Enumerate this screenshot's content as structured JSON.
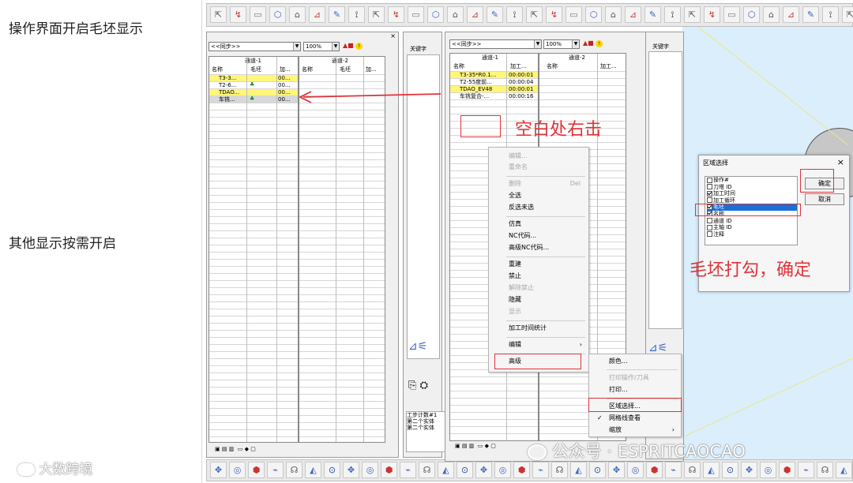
{
  "notes": {
    "left_top": "操作界面开启毛坯显示",
    "left_bottom": "其他显示按需开启",
    "right_click_hint": "空白处右击",
    "check_hint": "毛坯打勾，确定"
  },
  "watermarks": {
    "logo": "大数跨境",
    "wechat": "公众号 · ESPRITCAOCAO"
  },
  "panel_left": {
    "sync_combo": "<<同步>>",
    "zoom_combo": "100%",
    "channel1": "通道-1",
    "channel2": "通道-2",
    "cols1": [
      "名称",
      "毛坯",
      "加..."
    ],
    "cols2": [
      "名称",
      "毛坯",
      "加..."
    ],
    "rows": [
      {
        "name": "T3-3...",
        "stock": "",
        "time": "00...",
        "highlight": true
      },
      {
        "name": "T2-6...",
        "stock": "stock-icon",
        "time": "00...",
        "highlight": false
      },
      {
        "name": "TDAO...",
        "stock": "",
        "time": "00...",
        "highlight": true
      },
      {
        "name": "车铣...",
        "stock": "stock-icon",
        "time": "00...",
        "highlight": false,
        "gray": true
      }
    ],
    "keyword": "关键字"
  },
  "panel_right": {
    "sync_combo": "<<同步>>",
    "zoom_combo": "100%",
    "channel1": "通道-1",
    "channel2": "通道-2",
    "cols1": [
      "名称",
      "加工..."
    ],
    "cols2": [
      "名称",
      "加工..."
    ],
    "rows": [
      {
        "name": "T3-35*R0.1...",
        "time": "00:00:01",
        "highlight": true
      },
      {
        "name": "T2-55度前...",
        "time": "00:00:04",
        "highlight": false
      },
      {
        "name": "TDAO_EV48",
        "time": "00:00:01",
        "highlight": true
      },
      {
        "name": "车铣复合-...",
        "time": "00:00:16",
        "highlight": false
      }
    ],
    "keyword": "关键字"
  },
  "context_menu": {
    "items": [
      {
        "label": "编辑...",
        "disabled": true
      },
      {
        "label": "重命名",
        "disabled": true
      },
      {
        "label": "删除",
        "shortcut": "Del",
        "disabled": true
      },
      {
        "label": "全选",
        "disabled": false
      },
      {
        "label": "反选未选",
        "disabled": false
      },
      {
        "label": "仿真",
        "disabled": false
      },
      {
        "label": "NC代码...",
        "disabled": false
      },
      {
        "label": "高级NC代码...",
        "disabled": false
      },
      {
        "label": "重建",
        "disabled": false
      },
      {
        "label": "禁止",
        "disabled": false
      },
      {
        "label": "解除禁止",
        "disabled": true
      },
      {
        "label": "隐藏",
        "disabled": false
      },
      {
        "label": "显示",
        "disabled": true
      },
      {
        "label": "加工时间统计",
        "disabled": false
      },
      {
        "label": "编辑",
        "disabled": false
      },
      {
        "label": "高级",
        "disabled": false
      }
    ]
  },
  "submenu": {
    "items": [
      {
        "label": "颜色...",
        "disabled": false
      },
      {
        "label": "打印操作/刀具",
        "disabled": true
      },
      {
        "label": "打印...",
        "disabled": false
      },
      {
        "label": "区域选择...",
        "disabled": false
      },
      {
        "label": "网格线查看",
        "disabled": false,
        "checked": true
      },
      {
        "label": "缩放",
        "disabled": false
      }
    ]
  },
  "dialog": {
    "title": "区域选择",
    "close": "×",
    "ok": "确定",
    "cancel": "取消",
    "options": [
      {
        "label": "操作#",
        "checked": false
      },
      {
        "label": "刀塔 ID",
        "checked": false
      },
      {
        "label": "加工时间",
        "checked": true
      },
      {
        "label": "加工循环",
        "checked": false
      },
      {
        "label": "毛坯",
        "checked": true,
        "selected": true
      },
      {
        "label": "名称",
        "checked": true
      },
      {
        "label": "通道 ID",
        "checked": false
      },
      {
        "label": "主轴 ID",
        "checked": false
      },
      {
        "label": "注释",
        "checked": false
      }
    ]
  },
  "status_text": [
    "工步计数#1",
    "第二个实体",
    "第二个实体"
  ],
  "colors": {
    "accent_red": "#e0333a",
    "highlight_yellow": "#fff67a",
    "selection_blue": "#1a6fd6"
  }
}
